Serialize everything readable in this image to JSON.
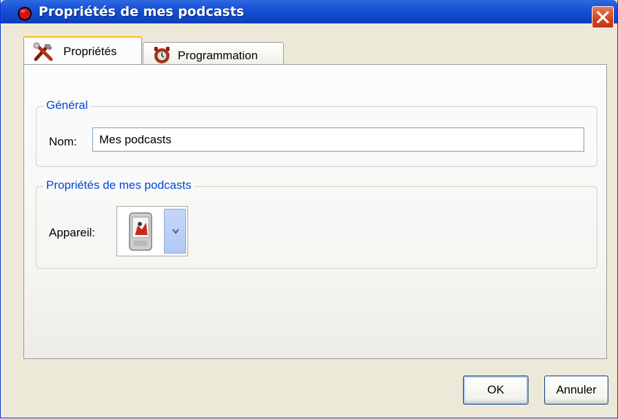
{
  "window": {
    "title": "Propriétés de mes podcasts",
    "icon": "red-record-icon",
    "close_icon": "close-icon"
  },
  "tabs": [
    {
      "label": "Propriétés",
      "icon": "tools-icon",
      "active": true
    },
    {
      "label": "Programmation",
      "icon": "schedule-icon",
      "active": false
    }
  ],
  "general": {
    "legend": "Général",
    "nom_label": "Nom:",
    "nom_value": "Mes podcasts"
  },
  "podcast_props": {
    "legend": "Propriétés de mes podcasts",
    "appareil_label": "Appareil:",
    "device_icon": "media-player-icon"
  },
  "buttons": {
    "ok": "OK",
    "cancel": "Annuler"
  },
  "colors": {
    "titlebar": "#0b3fb9",
    "legend": "#0046d5",
    "tab_highlight": "#ffc83c",
    "close": "#d4401c"
  }
}
